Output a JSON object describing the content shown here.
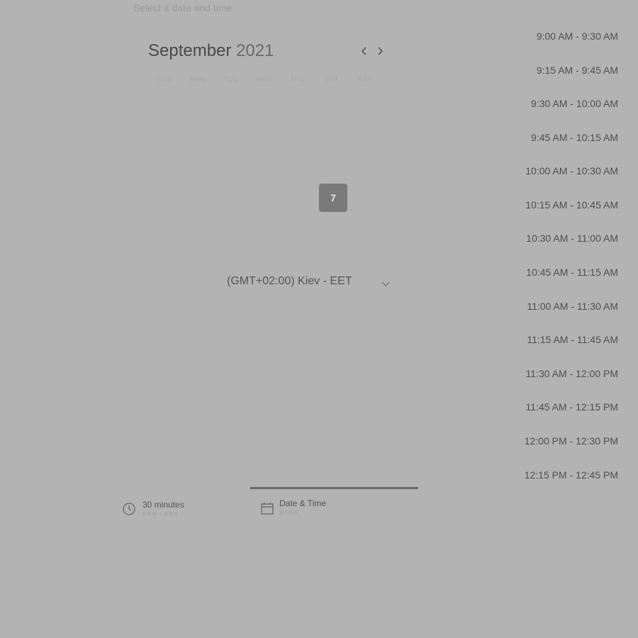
{
  "prompt": "Select a date and time",
  "calendar": {
    "month": "September",
    "year": "2021",
    "weekdays": [
      "SUN",
      "MON",
      "TUE",
      "WED",
      "THU",
      "FRI",
      "SAT"
    ],
    "selected_day": "7"
  },
  "timezone": "(GMT+02:00) Kiev - EET",
  "time_slots": [
    "9:00 AM - 9:30 AM",
    "9:15 AM - 9:45 AM",
    "9:30 AM - 10:00 AM",
    "9:45 AM - 10:15 AM",
    "10:00 AM - 10:30 AM",
    "10:15 AM - 10:45 AM",
    "10:30 AM - 11:00 AM",
    "10:45 AM - 11:15 AM",
    "11:00 AM - 11:30 AM",
    "11:15 AM - 11:45 AM",
    "11:30 AM - 12:00 PM",
    "11:45 AM - 12:15 PM",
    "12:00 PM - 12:30 PM",
    "12:15 PM - 12:45 PM"
  ],
  "steps": [
    {
      "label": "30 minutes",
      "sub": "HOW LONG",
      "icon": "clock-icon"
    },
    {
      "label": "Date & Time",
      "sub": "WHEN",
      "icon": "calendar-icon"
    }
  ]
}
